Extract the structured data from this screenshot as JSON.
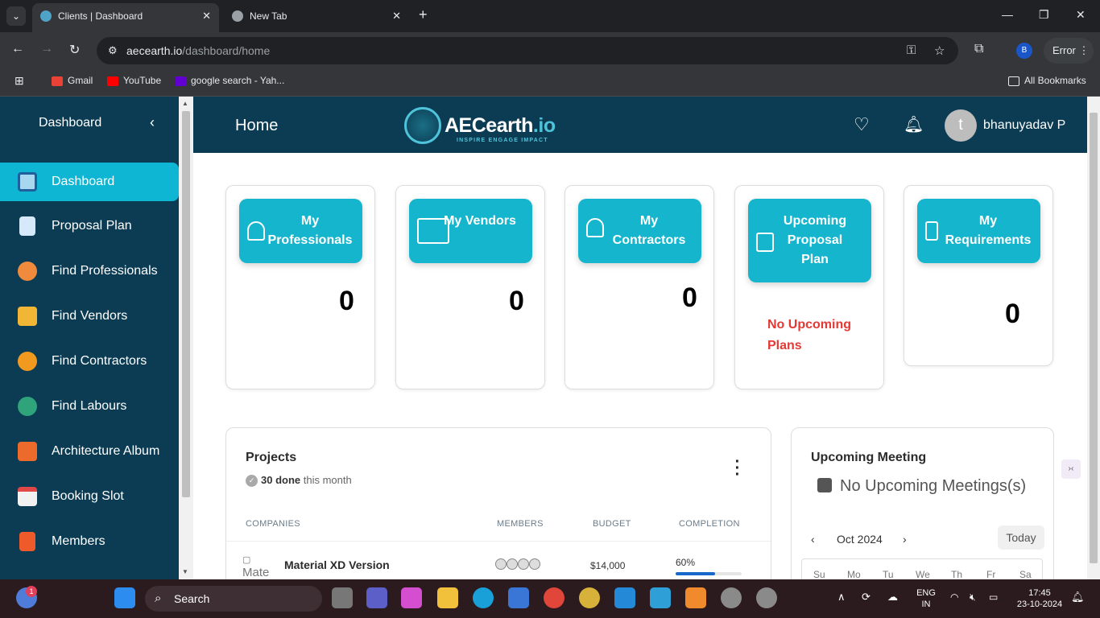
{
  "browser": {
    "tabs": [
      {
        "title": "Clients | Dashboard",
        "active": true
      },
      {
        "title": "New Tab",
        "active": false
      }
    ],
    "url_host": "aecearth.io",
    "url_path": "/dashboard/home",
    "profile_initial": "B",
    "error_label": "Error",
    "bookmarks": [
      {
        "label": "Gmail",
        "icon": "gmail-icon",
        "color": "#ea4335"
      },
      {
        "label": "YouTube",
        "icon": "youtube-icon",
        "color": "#ff0000"
      },
      {
        "label": "google search - Yah...",
        "icon": "yahoo-icon",
        "color": "#6001d2"
      }
    ],
    "all_bookmarks": "All Bookmarks"
  },
  "sidebar": {
    "title": "Dashboard",
    "items": [
      {
        "label": "Dashboard",
        "icon": "dashboard-icon",
        "active": true
      },
      {
        "label": "Proposal Plan",
        "icon": "document-icon"
      },
      {
        "label": "Find Professionals",
        "icon": "professional-icon"
      },
      {
        "label": "Find Vendors",
        "icon": "store-icon"
      },
      {
        "label": "Find Contractors",
        "icon": "gear-icon"
      },
      {
        "label": "Find Labours",
        "icon": "labour-icon"
      },
      {
        "label": "Architecture Album",
        "icon": "album-icon"
      },
      {
        "label": "Booking Slot",
        "icon": "calendar-icon"
      },
      {
        "label": "Members",
        "icon": "members-icon"
      }
    ]
  },
  "header": {
    "title": "Home",
    "logo_main": "AECearth",
    "logo_suffix": ".io",
    "logo_tagline": "INSPIRE ENGAGE IMPACT",
    "avatar_initial": "t",
    "username": "bhanuyadav P"
  },
  "cards": [
    {
      "label": "My Professionals",
      "value": "0"
    },
    {
      "label": "My Vendors",
      "value": "0"
    },
    {
      "label": "My Contractors",
      "value": "0"
    },
    {
      "label": "Upcoming Proposal Plan",
      "empty_text": "No Upcoming Plans"
    },
    {
      "label": "My Requirements",
      "value": "0"
    }
  ],
  "projects": {
    "title": "Projects",
    "done_count": "30 done",
    "done_suffix": "this month",
    "columns": [
      "COMPANIES",
      "MEMBERS",
      "BUDGET",
      "COMPLETION"
    ],
    "rows": [
      {
        "company": "Material XD Version",
        "img_alt": "Mate",
        "budget": "$14,000",
        "completion": "60%",
        "completion_value": 0.6
      }
    ]
  },
  "meetings": {
    "title": "Upcoming Meeting",
    "empty_text": "No Upcoming Meetings(s)",
    "month": "Oct 2024",
    "today_label": "Today",
    "weekdays": [
      "Su",
      "Mo",
      "Tu",
      "We",
      "Th",
      "Fr",
      "Sa"
    ]
  },
  "taskbar": {
    "search_label": "Search",
    "lang_1": "ENG",
    "lang_2": "IN",
    "time": "17:45",
    "date": "23-10-2024",
    "notif_count": "1"
  }
}
